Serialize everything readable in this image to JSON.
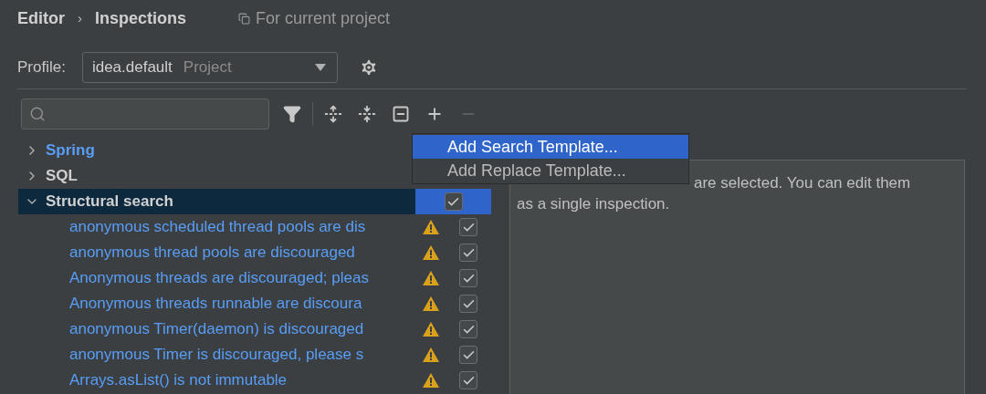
{
  "breadcrumb": {
    "items": [
      "Editor",
      "Inspections"
    ],
    "separator": "›",
    "scope": "For current project"
  },
  "profile": {
    "label": "Profile:",
    "value": "idea.default",
    "scope": "Project"
  },
  "toolbar": [
    {
      "kind": "filter",
      "disabled": false
    },
    {
      "kind": "expand",
      "disabled": false
    },
    {
      "kind": "collapse",
      "disabled": false
    },
    {
      "kind": "reset",
      "disabled": false
    },
    {
      "kind": "add",
      "disabled": false
    },
    {
      "kind": "remove",
      "disabled": true
    }
  ],
  "tree": [
    {
      "name": "Spring",
      "modified": true,
      "expanded": false,
      "selected": false
    },
    {
      "name": "SQL",
      "modified": false,
      "expanded": false,
      "selected": false
    },
    {
      "name": "Structural search",
      "modified": false,
      "expanded": true,
      "selected": true,
      "checked": true,
      "children": [
        {
          "name": "anonymous scheduled thread pools are dis",
          "warning": true,
          "checked": true
        },
        {
          "name": "anonymous thread pools are discouraged",
          "warning": true,
          "checked": true
        },
        {
          "name": "Anonymous threads are discouraged; pleas",
          "warning": true,
          "checked": true
        },
        {
          "name": "Anonymous threads runnable are discoura",
          "warning": true,
          "checked": true
        },
        {
          "name": "anonymous Timer(daemon) is discouraged",
          "warning": true,
          "checked": true
        },
        {
          "name": "anonymous Timer is discouraged, please s",
          "warning": true,
          "checked": true
        },
        {
          "name": "Arrays.asList() is not immutable",
          "warning": true,
          "checked": true
        }
      ]
    }
  ],
  "description": [
    "are selected. You can edit them",
    "as a single inspection."
  ],
  "menu": [
    {
      "label": "Add Search Template...",
      "selected": true
    },
    {
      "label": "Add Replace Template...",
      "selected": false
    }
  ]
}
